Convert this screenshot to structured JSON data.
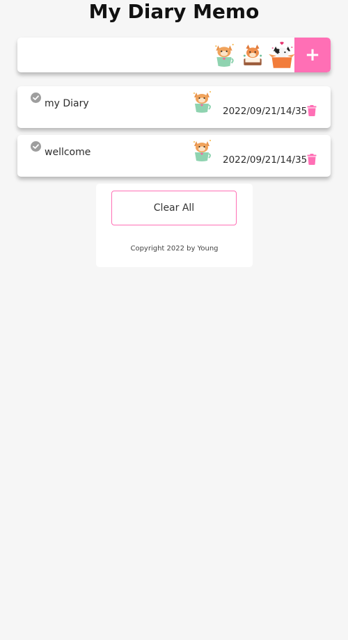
{
  "header": {
    "title": "My Diary Memo"
  },
  "input_bar": {
    "value": "",
    "placeholder": "",
    "stickers": [
      "cat-with-cup-sticker",
      "dog-with-book-sticker",
      "cat-in-box-sticker"
    ],
    "add_label": "+"
  },
  "memos": [
    {
      "text": "my Diary",
      "date": "2022/09/21/14/35",
      "sticker": "cat-with-cup-sticker",
      "done": false
    },
    {
      "text": "wellcome",
      "date": "2022/09/21/14/35",
      "sticker": "cat-with-cup-sticker",
      "done": false
    }
  ],
  "footer": {
    "clear_label": "Clear All",
    "copyright": "Copyright 2022 by Young"
  },
  "colors": {
    "accent": "#ff6fb5",
    "background": "#f6f6f6",
    "card": "#ffffff",
    "check": "#9e9e9e"
  }
}
